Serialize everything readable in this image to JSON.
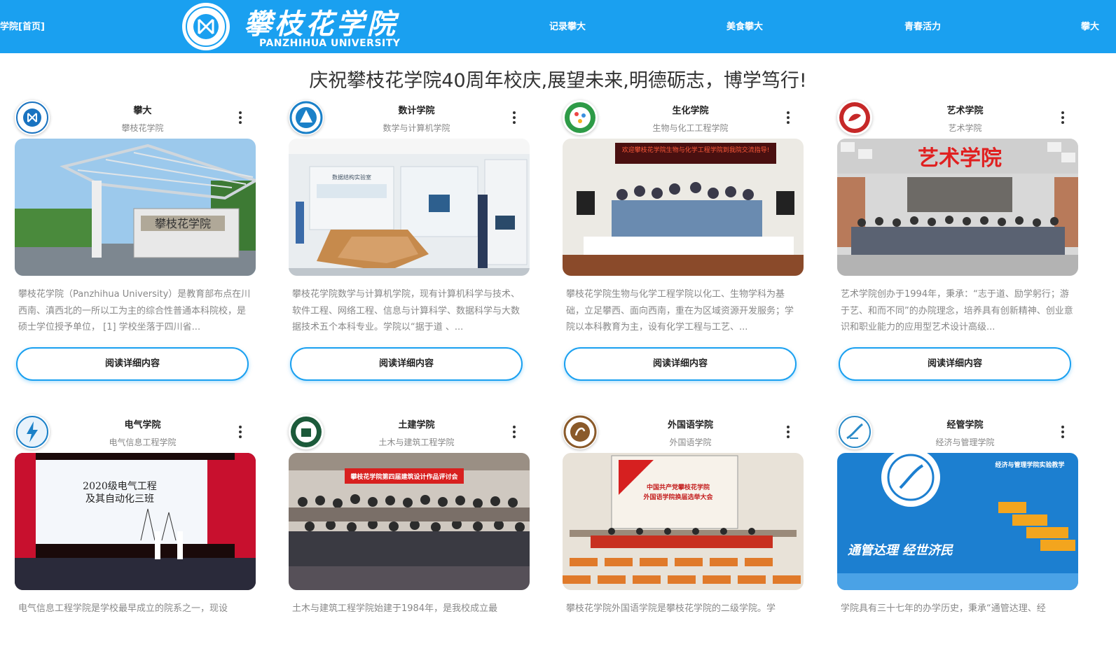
{
  "nav": {
    "home_label": "学院[首页]",
    "links": [
      "记录攀大",
      "美食攀大",
      "青春活力",
      "攀大"
    ]
  },
  "brand": {
    "name_cn": "攀枝花学院",
    "name_en": "PANZHIHUA UNIVERSITY"
  },
  "headline": "庆祝攀枝花学院40周年校庆,展望未来,明德砺志，博学笃行!",
  "cards": [
    {
      "title": "攀大",
      "subtitle": "攀枝花学院",
      "desc": "攀枝花学院（Panzhihua University）是教育部布点在川西南、滇西北的一所以工为主的综合性普通本科院校，是硕士学位授予单位， [1] 学校坐落于四川省...",
      "button": "阅读详细内容"
    },
    {
      "title": "数计学院",
      "subtitle": "数学与计算机学院",
      "desc": "攀枝花学院数学与计算机学院，现有计算机科学与技术、软件工程、网络工程、信息与计算科学、数据科学与大数据技术五个本科专业。学院以“据于道 、...",
      "button": "阅读详细内容"
    },
    {
      "title": "生化学院",
      "subtitle": "生物与化工工程学院",
      "desc": "攀枝花学院生物与化学工程学院以化工、生物学科为基础，立足攀西、面向西南，重在为区域资源开发服务；学院以本科教育为主，设有化学工程与工艺、...",
      "button": "阅读详细内容"
    },
    {
      "title": "艺术学院",
      "subtitle": "艺术学院",
      "desc": "艺术学院创办于1994年，秉承：“志于道、励学躬行；游于艺、和而不同”的办院理念，培养具有创新精神、创业意识和职业能力的应用型艺术设计高级...",
      "button": "阅读详细内容"
    },
    {
      "title": "电气学院",
      "subtitle": "电气信息工程学院",
      "desc": "电气信息工程学院是学校最早成立的院系之一，现设",
      "button": ""
    },
    {
      "title": "土建学院",
      "subtitle": "土木与建筑工程学院",
      "desc": "土木与建筑工程学院始建于1984年，是我校成立最",
      "button": ""
    },
    {
      "title": "外国语学院",
      "subtitle": "外国语学院",
      "desc": "攀枝花学院外国语学院是攀枝花学院的二级学院。学",
      "button": ""
    },
    {
      "title": "经管学院",
      "subtitle": "经济与管理学院",
      "desc": "学院具有三十七年的办学历史，秉承“通管达理、经",
      "button": ""
    }
  ],
  "photo_text": {
    "c0_sign": "攀枝花学院",
    "c1_sign": "数据结构实验室",
    "c2_banner": "欢迎攀枝花学院生物与化学工程学院到我院交流指导!",
    "c3_sign": "艺术学院",
    "c4_screen_1": "2020级电气工程",
    "c4_screen_2": "及其自动化三班",
    "c5_banner": "攀枝花学院第四届建筑设计作品评讨会",
    "c6_screen_1": "中国共产党攀枝花学院",
    "c6_screen_2": "外国语学院换届选举大会",
    "c7_sign_1": "经济与管理学院实验教学",
    "c7_sign_2": "通管达理 经世济民"
  },
  "colors": {
    "accent": "#1aa0f0",
    "text_muted": "#888888"
  }
}
